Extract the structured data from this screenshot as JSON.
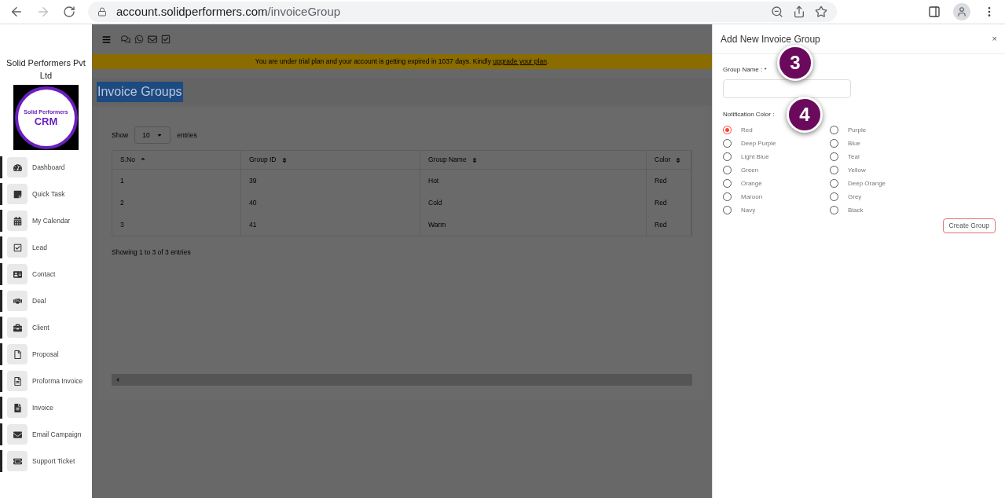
{
  "browser": {
    "url_domain": "account.solidperformers.com",
    "url_path": "/invoiceGroup"
  },
  "sidebar": {
    "company": "Solid Performers Pvt Ltd",
    "logo": {
      "line1": "Solid Performers",
      "line2": "CRM"
    },
    "items": [
      {
        "label": "Dashboard"
      },
      {
        "label": "Quick Task"
      },
      {
        "label": "My Calendar"
      },
      {
        "label": "Lead"
      },
      {
        "label": "Contact"
      },
      {
        "label": "Deal"
      },
      {
        "label": "Client"
      },
      {
        "label": "Proposal"
      },
      {
        "label": "Proforma Invoice"
      },
      {
        "label": "Invoice"
      },
      {
        "label": "Email Campaign"
      },
      {
        "label": "Support Ticket"
      }
    ]
  },
  "banner": {
    "text": "You are under trial plan and your account is getting expired in 1037 days. Kindly",
    "link": "upgrade your plan",
    "end": "."
  },
  "page_title": "Invoice Groups",
  "table": {
    "show_label": "Show",
    "page_size": "10",
    "entries_label": "entries",
    "columns": [
      {
        "label": "S.No",
        "sorted": true
      },
      {
        "label": "Group ID",
        "sorted": false
      },
      {
        "label": "Group Name",
        "sorted": false
      },
      {
        "label": "Color",
        "sorted": false
      }
    ],
    "rows": [
      [
        "1",
        "39",
        "Hot",
        "Red"
      ],
      [
        "2",
        "40",
        "Cold",
        "Red"
      ],
      [
        "3",
        "41",
        "Warm",
        "Red"
      ]
    ],
    "info": "Showing 1 to 3 of 3 entries"
  },
  "drawer": {
    "title": "Add New Invoice Group",
    "close": "×",
    "group_name_label": "Group Name : *",
    "color_label": "Notification Color :",
    "colors": [
      {
        "label": "Red",
        "selected": true
      },
      {
        "label": "Purple",
        "selected": false
      },
      {
        "label": "Deep Purple",
        "selected": false
      },
      {
        "label": "Blue",
        "selected": false
      },
      {
        "label": "Light Blue",
        "selected": false
      },
      {
        "label": "Teal",
        "selected": false
      },
      {
        "label": "Green",
        "selected": false
      },
      {
        "label": "Yellow",
        "selected": false
      },
      {
        "label": "Orange",
        "selected": false
      },
      {
        "label": "Deep Orange",
        "selected": false
      },
      {
        "label": "Maroon",
        "selected": false
      },
      {
        "label": "Grey",
        "selected": false
      },
      {
        "label": "Navy",
        "selected": false
      },
      {
        "label": "Black",
        "selected": false
      }
    ],
    "button": "Create Group"
  },
  "step_markers": [
    "3",
    "4"
  ]
}
